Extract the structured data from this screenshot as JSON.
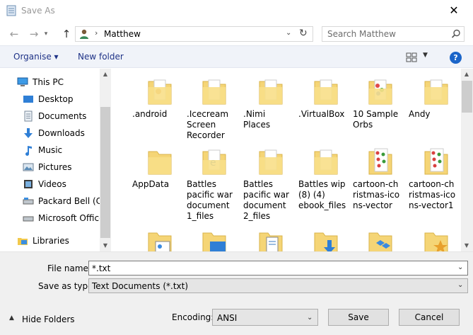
{
  "window": {
    "title": "Save As",
    "close_glyph": "✕"
  },
  "navigation": {
    "back_glyph": "←",
    "forward_glyph": "→",
    "recent_glyph": "▾",
    "up_glyph": "↑",
    "location": "Matthew",
    "separator": "›",
    "search_placeholder": "Search Matthew"
  },
  "toolbar": {
    "organise_label": "Organise ▾",
    "new_folder_label": "New folder",
    "view_dropdown_glyph": "▼",
    "help_label": "?"
  },
  "sidebar": {
    "items": [
      {
        "label": "This PC",
        "icon": "pc-icon"
      },
      {
        "label": "Desktop",
        "icon": "desktop-icon"
      },
      {
        "label": "Documents",
        "icon": "documents-icon"
      },
      {
        "label": "Downloads",
        "icon": "downloads-icon"
      },
      {
        "label": "Music",
        "icon": "music-icon"
      },
      {
        "label": "Pictures",
        "icon": "pictures-icon"
      },
      {
        "label": "Videos",
        "icon": "videos-icon"
      },
      {
        "label": "Packard Bell (C:)",
        "icon": "drive-icon"
      },
      {
        "label": "Microsoft Office",
        "icon": "drive-icon"
      },
      {
        "label": "Libraries",
        "icon": "libraries-icon"
      }
    ]
  },
  "files": {
    "row1": [
      ".android",
      ".Icecream\nScreen\nRecorder",
      ".Nimi\nPlaces",
      ".VirtualBox",
      "10 Sample\nOrbs",
      "Andy"
    ],
    "row2": [
      "AppData",
      "Battles\npacific war\ndocument\n1_files",
      "Battles\npacific war\ndocument\n2_files",
      "Battles wip\n(8) (4)\nebook_files",
      "cartoon-ch\nristmas-ico\nns-vector",
      "cartoon-ch\nristmas-ico\nns-vector1"
    ]
  },
  "form": {
    "filename_label": "File name:",
    "filename_value": "*.txt",
    "savetype_label": "Save as type:",
    "savetype_value": "Text Documents (*.txt)",
    "encoding_label": "Encoding:",
    "encoding_value": "ANSI",
    "hide_folders_label": "Hide Folders",
    "save_label": "Save",
    "cancel_label": "Cancel"
  },
  "colors": {
    "folder": "#f5d576",
    "accent": "#1b65c9",
    "link": "#1e3287"
  }
}
